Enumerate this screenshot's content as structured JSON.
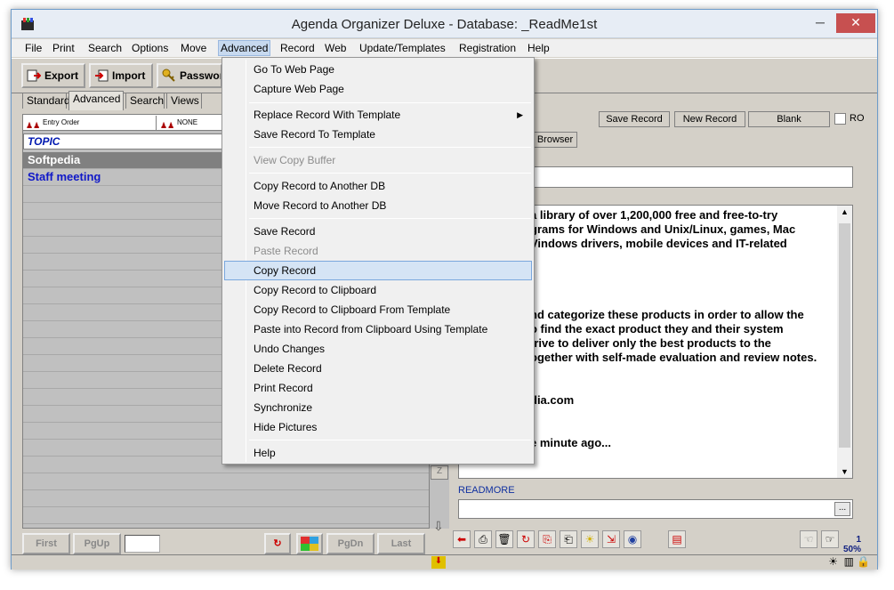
{
  "window": {
    "title": "Agenda Organizer Deluxe - Database: _ReadMe1st",
    "minimize": "─",
    "close": "✕"
  },
  "menubar": [
    "File",
    "Print",
    "Search",
    "Options",
    "Move",
    "Advanced",
    "Record",
    "Web",
    "Update/Templates",
    "Registration",
    "Help"
  ],
  "toolbar": {
    "export_label": "Export",
    "import_label": "Import",
    "password_label": "Passwor"
  },
  "tabs": [
    "Standard",
    "Advanced",
    "Search",
    "Views"
  ],
  "sort": {
    "primary": "Entry Order",
    "secondary": "NONE"
  },
  "list": {
    "header": "TOPIC",
    "rows": [
      "Softpedia",
      "Staff meeting"
    ]
  },
  "nav": {
    "first": "First",
    "pgup": "PgUp",
    "pgdn": "PgDn",
    "last": "Last"
  },
  "record_buttons": {
    "save": "Save Record",
    "new": "New Record",
    "blank": "Blank",
    "ro": "RO"
  },
  "browser_tab": "Browser",
  "memo_lines": [
    "a library of over 1,200,000 free and free-to-try",
    "grams for Windows and Unix/Linux, games, Mac",
    "Vindows drivers, mobile devices and IT-related",
    "",
    "",
    "",
    "",
    "nd categorize these products in order to allow the",
    "o find the exact product they and their system",
    "trive to deliver only the best products to the",
    "ogether with self-made evaluation and review notes.",
    "",
    "",
    "dia.com",
    "",
    "",
    "e minute ago..."
  ],
  "readmore_label": "READMORE",
  "readmore_button": "...",
  "status": {
    "count": "1",
    "percent": "50%"
  },
  "dropdown": {
    "items": [
      {
        "label": "Go To Web Page",
        "state": "normal"
      },
      {
        "label": "Capture Web Page",
        "state": "normal"
      },
      {
        "label": "Replace Record With Template",
        "state": "submenu"
      },
      {
        "label": "Save Record To Template",
        "state": "normal"
      },
      {
        "label": "View Copy Buffer",
        "state": "disabled"
      },
      {
        "label": "Copy Record to Another DB",
        "state": "normal"
      },
      {
        "label": "Move Record to Another DB",
        "state": "normal"
      },
      {
        "label": "Save Record",
        "state": "normal"
      },
      {
        "label": "Paste Record",
        "state": "disabled"
      },
      {
        "label": "Copy Record",
        "state": "highlighted"
      },
      {
        "label": "Copy Record to Clipboard",
        "state": "normal"
      },
      {
        "label": "Copy Record to Clipboard From Template",
        "state": "normal"
      },
      {
        "label": "Paste into Record from Clipboard Using Template",
        "state": "normal"
      },
      {
        "label": "Undo Changes",
        "state": "normal"
      },
      {
        "label": "Delete Record",
        "state": "normal"
      },
      {
        "label": "Print Record",
        "state": "normal"
      },
      {
        "label": "Synchronize",
        "state": "normal"
      },
      {
        "label": "Hide Pictures",
        "state": "normal"
      },
      {
        "label": "Help",
        "state": "normal"
      }
    ]
  },
  "colors": {
    "accent": "#1018c8",
    "highlight": "#d5e4f5",
    "close": "#c75050"
  }
}
